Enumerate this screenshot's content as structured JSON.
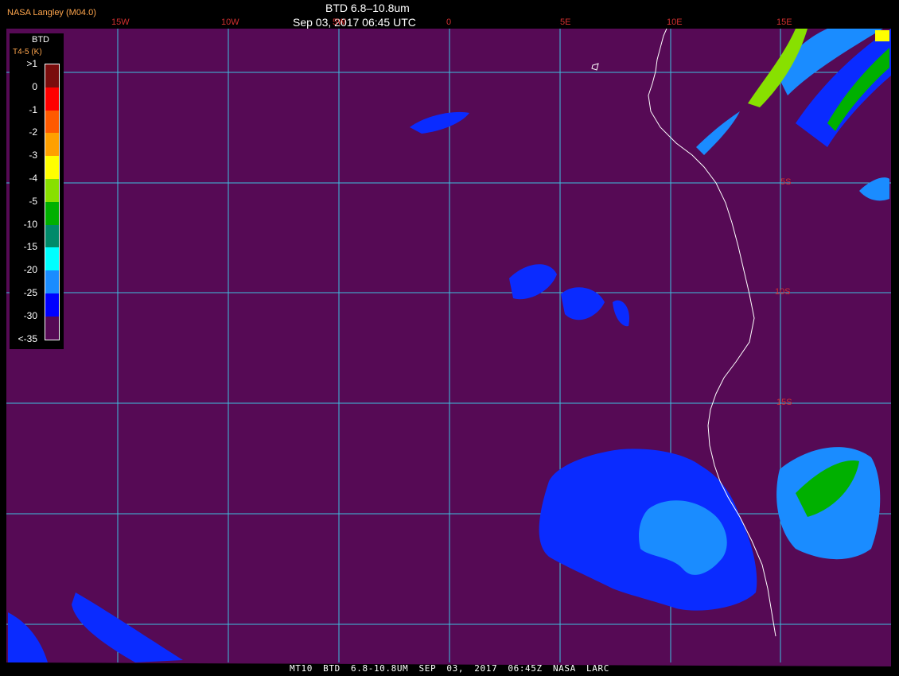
{
  "header": {
    "credit": "NASA Langley (M04.0)",
    "title": "BTD 6.8–10.8um",
    "timestamp": "Sep 03, 2017 06:45 UTC"
  },
  "footer": "MT10  BTD 6.8-10.8UM  SEP 03, 2017 06:45Z  NASA LARC",
  "legend": {
    "title": "BTD",
    "subtitle": "T4-5 (K)",
    "labels": [
      ">1",
      "0",
      "-1",
      "-2",
      "-3",
      "-4",
      "-5",
      "-10",
      "-15",
      "-20",
      "-25",
      "-30",
      "<-35"
    ],
    "colors": [
      "#7a0d0d",
      "#ff0000",
      "#ff5a00",
      "#ffa000",
      "#ffff00",
      "#88e000",
      "#00b000",
      "#008a6a",
      "#00ffff",
      "#1a8cff",
      "#0000ff",
      "#560a55"
    ]
  },
  "grid": {
    "lon_labels": [
      "15W",
      "10W",
      "5W",
      "0",
      "5E",
      "10E",
      "15E"
    ],
    "lat_labels": [
      "5S",
      "10S",
      "15S"
    ],
    "line_color": "#3ec0e0"
  },
  "colors": {
    "background": "#560a55",
    "low": "#1a8cff",
    "cold": "#0a2bff",
    "coast": "#ffffff"
  }
}
